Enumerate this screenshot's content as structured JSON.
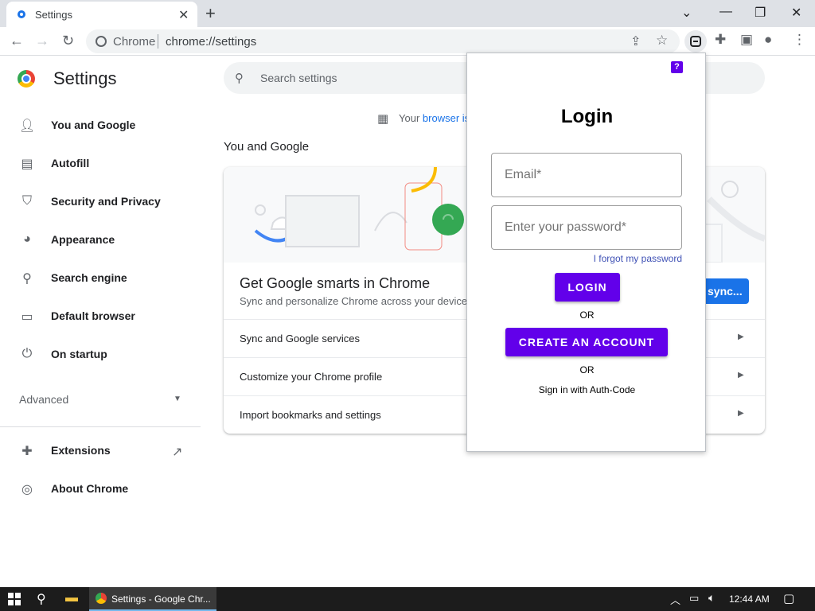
{
  "browser": {
    "tab_title": "Settings",
    "new_tab_symbol": "+",
    "window_controls": [
      "chevron-down-icon",
      "minimize-icon",
      "restore-icon",
      "close-icon"
    ],
    "omnibox": {
      "site_name": "Chrome",
      "url": "chrome://settings"
    }
  },
  "sidebar": {
    "title": "Settings",
    "items": [
      {
        "label": "You and Google",
        "icon": "person-icon"
      },
      {
        "label": "Autofill",
        "icon": "clipboard-icon"
      },
      {
        "label": "Security and Privacy",
        "icon": "shield-icon"
      },
      {
        "label": "Appearance",
        "icon": "palette-icon"
      },
      {
        "label": "Search engine",
        "icon": "search-icon"
      },
      {
        "label": "Default browser",
        "icon": "browser-icon"
      },
      {
        "label": "On startup",
        "icon": "power-icon"
      }
    ],
    "advanced": "Advanced",
    "extensions": "Extensions",
    "about": "About Chrome"
  },
  "main": {
    "search_placeholder": "Search settings",
    "managed_text": "Your",
    "managed_link": "browser is",
    "section_title": "You and Google",
    "card": {
      "heading": "Get Google smarts in Chrome",
      "subheading": "Sync and personalize Chrome across your devices",
      "sync_button": "sync...",
      "rows": [
        "Sync and Google services",
        "Customize your Chrome profile",
        "Import bookmarks and settings"
      ]
    }
  },
  "popup": {
    "title": "Login",
    "email_placeholder": "Email*",
    "password_placeholder": "Enter your password*",
    "forgot": "I forgot my password",
    "login_button": "LOGIN",
    "or1": "OR",
    "create_button": "CREATE AN ACCOUNT",
    "or2": "OR",
    "authcode": "Sign in with Auth-Code",
    "accent_color": "#6200ea"
  },
  "taskbar": {
    "chrome_task": "Settings - Google Chr...",
    "time": "12:44 AM"
  }
}
